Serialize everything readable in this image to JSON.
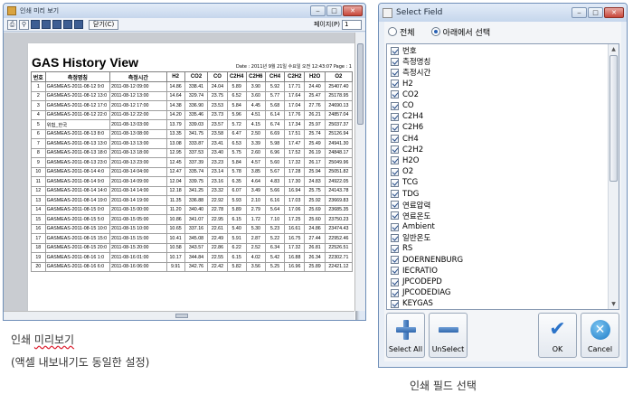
{
  "preview": {
    "window_title": "인쇄 미리 보기",
    "toolbar": {
      "print_icon": "printer-icon",
      "zoom_icon": "magnifier-icon",
      "close_label": "닫기(C)",
      "page_label": "페이지(P)",
      "page_value": "1"
    },
    "doc_title": "GAS History View",
    "doc_meta": "Date : 2011년 9월 21일 수요일 오전 12:43:07   Page : 1",
    "columns": [
      "번호",
      "측정명칭",
      "측정시간",
      "H2",
      "CO2",
      "CO",
      "C2H4",
      "C2H6",
      "CH4",
      "C2H2",
      "H2O",
      "O2"
    ],
    "rows": [
      [
        "1",
        "GASMEAS-2011-08-12 9:0",
        "2011-08-12 09:00",
        "14.86",
        "338.41",
        "24.04",
        "5.89",
        "3.90",
        "5.92",
        "17.71",
        "24.40",
        "25407.40"
      ],
      [
        "2",
        "GASMEAS-2011-08-12 13:0",
        "2011-08-12 13:00",
        "14.64",
        "329.74",
        "23.75",
        "6.52",
        "3.60",
        "5.77",
        "17.64",
        "25.47",
        "25178.95"
      ],
      [
        "3",
        "GASMEAS-2011-08-12 17:0",
        "2011-08-12 17:00",
        "14.38",
        "336.90",
        "23.53",
        "5.84",
        "4.45",
        "5.68",
        "17.04",
        "27.76",
        "24690.13"
      ],
      [
        "4",
        "GASMEAS-2011-08-12 22:0",
        "2011-08-12 22:00",
        "14.20",
        "335.46",
        "23.73",
        "5.96",
        "4.51",
        "6.14",
        "17.76",
        "26.21",
        "24857.04"
      ],
      [
        "5",
        "위험_한국",
        "2011-08-13 03:00",
        "13.79",
        "339.03",
        "23.57",
        "5.72",
        "4.15",
        "6.74",
        "17.34",
        "25.97",
        "25037.37"
      ],
      [
        "6",
        "GASMEAS-2011-08-13 8:0",
        "2011-08-13 08:00",
        "13.35",
        "341.75",
        "23.58",
        "6.47",
        "2.50",
        "6.69",
        "17.51",
        "25.74",
        "25126.94"
      ],
      [
        "7",
        "GASMEAS-2011-08-13 13:0",
        "2011-08-13 13:00",
        "13.08",
        "333.87",
        "23.41",
        "6.53",
        "3.39",
        "5.98",
        "17.47",
        "25.49",
        "24941.30"
      ],
      [
        "8",
        "GASMEAS-2011-08-13 18:0",
        "2011-08-13 18:00",
        "12.95",
        "337.53",
        "23.40",
        "5.75",
        "2.60",
        "6.96",
        "17.52",
        "26.19",
        "24848.17"
      ],
      [
        "9",
        "GASMEAS-2011-08-13 23:0",
        "2011-08-13 23:00",
        "12.45",
        "337.39",
        "23.23",
        "5.84",
        "4.57",
        "5.60",
        "17.32",
        "26.17",
        "25049.96"
      ],
      [
        "10",
        "GASMEAS-2011-08-14 4:0",
        "2011-08-14 04:00",
        "12.47",
        "335.74",
        "23.14",
        "5.78",
        "3.85",
        "5.67",
        "17.28",
        "25.94",
        "25051.82"
      ],
      [
        "11",
        "GASMEAS-2011-08-14 9:0",
        "2011-08-14 09:00",
        "12.04",
        "339.75",
        "23.16",
        "6.35",
        "4.64",
        "4.83",
        "17.30",
        "24.83",
        "24922.05"
      ],
      [
        "12",
        "GASMEAS-2011-08-14 14:0",
        "2011-08-14 14:00",
        "12.18",
        "341.25",
        "23.32",
        "6.07",
        "3.49",
        "5.66",
        "16.94",
        "25.75",
        "24143.78"
      ],
      [
        "13",
        "GASMEAS-2011-08-14 19:0",
        "2011-08-14 19:00",
        "11.35",
        "336.88",
        "22.92",
        "5.93",
        "2.10",
        "6.16",
        "17.03",
        "25.92",
        "23669.83"
      ],
      [
        "14",
        "GASMEAS-2011-08-15 0:0",
        "2011-08-15 00:00",
        "11.20",
        "340.40",
        "22.78",
        "5.89",
        "2.79",
        "5.64",
        "17.06",
        "25.69",
        "23685.35"
      ],
      [
        "15",
        "GASMEAS-2011-08-15 5:0",
        "2011-08-15 05:00",
        "10.86",
        "341.07",
        "22.95",
        "6.15",
        "1.72",
        "7.10",
        "17.25",
        "25.60",
        "23750.23"
      ],
      [
        "16",
        "GASMEAS-2011-08-15 10:0",
        "2011-08-15 10:00",
        "10.65",
        "337.16",
        "22.61",
        "5.40",
        "5.30",
        "5.23",
        "16.61",
        "24.86",
        "23474.43"
      ],
      [
        "17",
        "GASMEAS-2011-08-15 15:0",
        "2011-08-15 15:00",
        "10.41",
        "345.08",
        "22.49",
        "5.91",
        "2.87",
        "5.22",
        "16.75",
        "27.44",
        "22952.46"
      ],
      [
        "18",
        "GASMEAS-2011-08-15 20:0",
        "2011-08-15 20:00",
        "10.58",
        "343.57",
        "22.86",
        "6.22",
        "2.52",
        "6.34",
        "17.32",
        "26.81",
        "22526.51"
      ],
      [
        "19",
        "GASMEAS-2011-08-16 1:0",
        "2011-08-16 01:00",
        "10.17",
        "344.84",
        "22.55",
        "6.15",
        "4.02",
        "5.42",
        "16.88",
        "26.34",
        "22302.71"
      ],
      [
        "20",
        "GASMEAS-2011-08-16 6:0",
        "2011-08-16 06:00",
        "9.91",
        "342.76",
        "22.42",
        "5.82",
        "3.56",
        "5.25",
        "16.96",
        "25.89",
        "22421.12"
      ]
    ]
  },
  "captions": {
    "left_line1_pre": "인쇄 ",
    "left_line1_word": "미리보기",
    "left_line2": "(액셀 내보내기도 동일한 설정)",
    "right": "인쇄 필드 선택"
  },
  "select_field": {
    "title": "Select Field",
    "radio_all": "전체",
    "radio_select": "아래에서 선택",
    "fields": [
      "번호",
      "측정명칭",
      "측정시간",
      "H2",
      "CO2",
      "CO",
      "C2H4",
      "C2H6",
      "CH4",
      "C2H2",
      "H2O",
      "O2",
      "TCG",
      "TDG",
      "연료압력",
      "연료온도",
      "Ambient",
      "일반온도",
      "RS",
      "DOERNENBURG",
      "IECRATIO",
      "JPCODEPD",
      "JPCODEDIAG",
      "KEYGAS"
    ],
    "buttons": {
      "select_all": "Select All",
      "unselect": "UnSelect",
      "ok": "OK",
      "cancel": "Cancel"
    }
  }
}
